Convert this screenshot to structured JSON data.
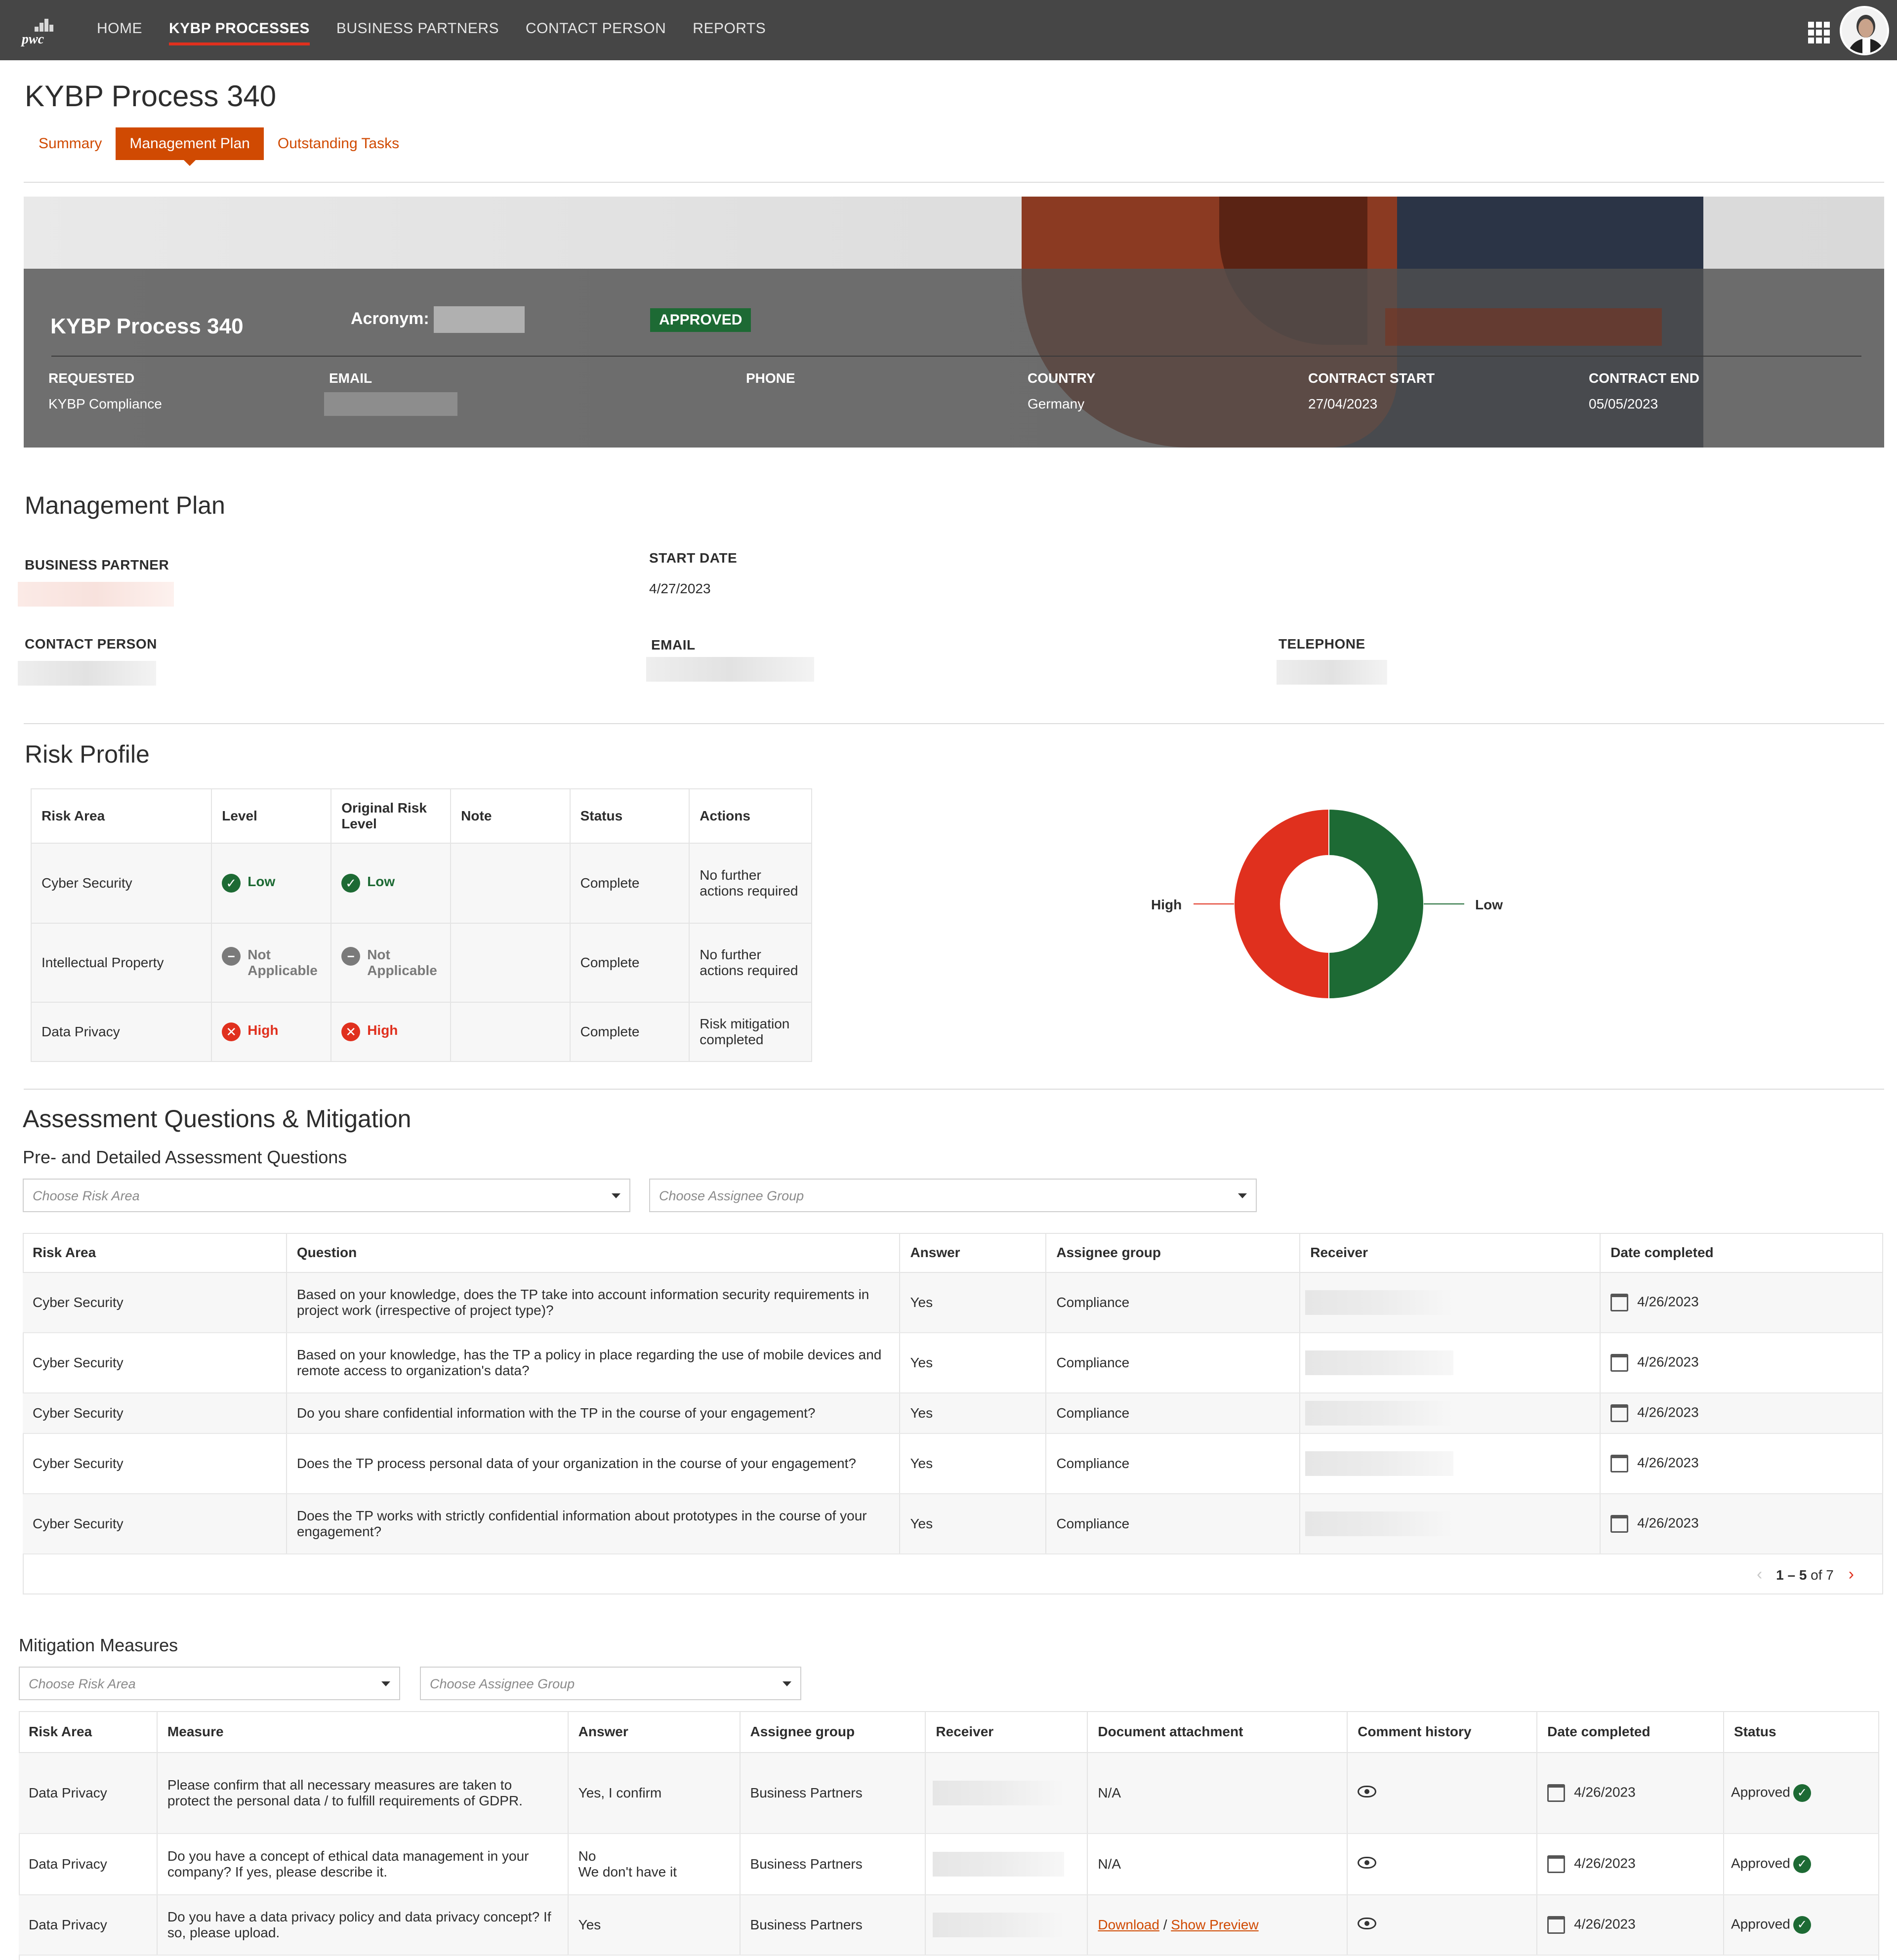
{
  "nav": {
    "logo_text": "pwc",
    "items": [
      "HOME",
      "KYBP PROCESSES",
      "BUSINESS PARTNERS",
      "CONTACT PERSON",
      "REPORTS"
    ],
    "active": "KYBP PROCESSES"
  },
  "page": {
    "title": "KYBP Process 340",
    "tabs": [
      "Summary",
      "Management Plan",
      "Outstanding Tasks"
    ],
    "active_tab": "Management Plan"
  },
  "hero": {
    "title": "KYBP Process 340",
    "acronym_label": "Acronym:",
    "status_badge": "APPROVED",
    "fields": {
      "requested_label": "REQUESTED",
      "requested_value": "KYBP Compliance",
      "email_label": "EMAIL",
      "phone_label": "PHONE",
      "country_label": "COUNTRY",
      "country_value": "Germany",
      "contract_start_label": "CONTRACT START",
      "contract_start_value": "27/04/2023",
      "contract_end_label": "CONTRACT END",
      "contract_end_value": "05/05/2023"
    }
  },
  "management_plan": {
    "title": "Management Plan",
    "business_partner_label": "BUSINESS PARTNER",
    "start_date_label": "START DATE",
    "start_date_value": "4/27/2023",
    "contact_person_label": "CONTACT PERSON",
    "email_label": "EMAIL",
    "telephone_label": "TELEPHONE"
  },
  "risk_profile": {
    "title": "Risk Profile",
    "columns": [
      "Risk Area",
      "Level",
      "Original Risk Level",
      "Note",
      "Status",
      "Actions"
    ],
    "rows": [
      {
        "area": "Cyber Security",
        "level": "Low",
        "original": "Low",
        "note": "",
        "status": "Complete",
        "actions": "No further actions required"
      },
      {
        "area": "Intellectual Property",
        "level": "Not Applicable",
        "original": "Not Applicable",
        "note": "",
        "status": "Complete",
        "actions": "No further actions required"
      },
      {
        "area": "Data Privacy",
        "level": "High",
        "original": "High",
        "note": "",
        "status": "Complete",
        "actions": "Risk mitigation completed"
      }
    ]
  },
  "chart_data": {
    "type": "pie",
    "categories": [
      "High",
      "Low"
    ],
    "values": [
      50,
      50
    ],
    "colors": [
      "#e0301e",
      "#1d6a34"
    ],
    "title": "",
    "donut": true
  },
  "assessment": {
    "title": "Assessment Questions & Mitigation",
    "subtitle": "Pre- and Detailed Assessment Questions",
    "risk_area_placeholder": "Choose Risk Area",
    "assignee_placeholder": "Choose Assignee Group",
    "columns": [
      "Risk Area",
      "Question",
      "Answer",
      "Assignee group",
      "Receiver",
      "Date completed"
    ],
    "rows": [
      {
        "area": "Cyber Security",
        "question": "Based on your knowledge, does the TP take into account information security requirements in project work (irrespective of project type)?",
        "answer": "Yes",
        "group": "Compliance",
        "date": "4/26/2023"
      },
      {
        "area": "Cyber Security",
        "question": "Based on your knowledge, has the TP a policy in place regarding the use of mobile devices and remote access to organization's data?",
        "answer": "Yes",
        "group": "Compliance",
        "date": "4/26/2023"
      },
      {
        "area": "Cyber Security",
        "question": "Do you share confidential information with the TP in the course of your engagement?",
        "answer": "Yes",
        "group": "Compliance",
        "date": "4/26/2023"
      },
      {
        "area": "Cyber Security",
        "question": "Does the TP process personal data of your organization in the course of your engagement?",
        "answer": "Yes",
        "group": "Compliance",
        "date": "4/26/2023"
      },
      {
        "area": "Cyber Security",
        "question": "Does the TP works with strictly confidential information about prototypes in the course of your engagement?",
        "answer": "Yes",
        "group": "Compliance",
        "date": "4/26/2023"
      }
    ],
    "pager": {
      "range": "1 – 5",
      "of_label": "of 7"
    }
  },
  "mitigation": {
    "title": "Mitigation Measures",
    "risk_area_placeholder": "Choose Risk Area",
    "assignee_placeholder": "Choose Assignee Group",
    "columns": [
      "Risk Area",
      "Measure",
      "Answer",
      "Assignee group",
      "Receiver",
      "Document attachment",
      "Comment history",
      "Date completed",
      "Status"
    ],
    "rows": [
      {
        "area": "Data Privacy",
        "measure": "Please confirm that all necessary measures are taken to protect the personal data / to fulfill requirements of GDPR.",
        "answer_l1": "Yes, I confirm",
        "answer_l2": "",
        "group": "Business Partners",
        "attachment": "N/A",
        "date": "4/26/2023",
        "status": "Approved"
      },
      {
        "area": "Data Privacy",
        "measure": "Do you have a concept of ethical data management in your company? If yes, please describe it.",
        "answer_l1": "No",
        "answer_l2": "We don't have it",
        "group": "Business Partners",
        "attachment": "N/A",
        "date": "4/26/2023",
        "status": "Approved"
      },
      {
        "area": "Data Privacy",
        "measure": "Do you have a data privacy policy and data privacy concept? If so, please upload.",
        "answer_l1": "Yes",
        "answer_l2": "",
        "group": "Business Partners",
        "download_label": "Download",
        "separator": "/",
        "preview_label": "Show Preview",
        "date": "4/26/2023",
        "status": "Approved"
      }
    ]
  }
}
